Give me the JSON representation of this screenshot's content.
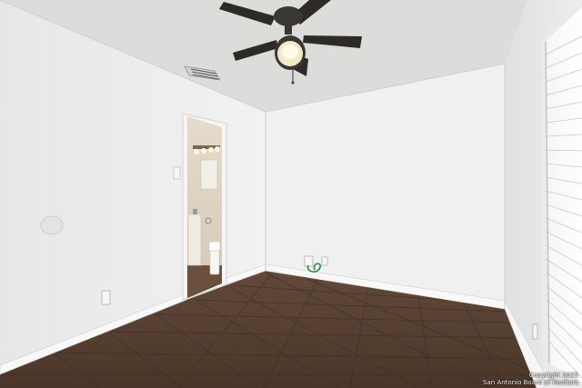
{
  "photo": {
    "subject": "empty bedroom",
    "watermark": {
      "line1": "Copyright 2025",
      "line2": "San Antonio Board of Realtors"
    }
  },
  "colors": {
    "ceiling": "#dcdcdc",
    "wall_left": "#ebeceb",
    "wall_back": "#f0f1f0",
    "wall_right": "#e4e5e4",
    "baseboard": "#f7f7f7",
    "floor_tile": "#55402f",
    "fan_blade": "#2d2a28",
    "fan_light": "#f2e6c4"
  }
}
